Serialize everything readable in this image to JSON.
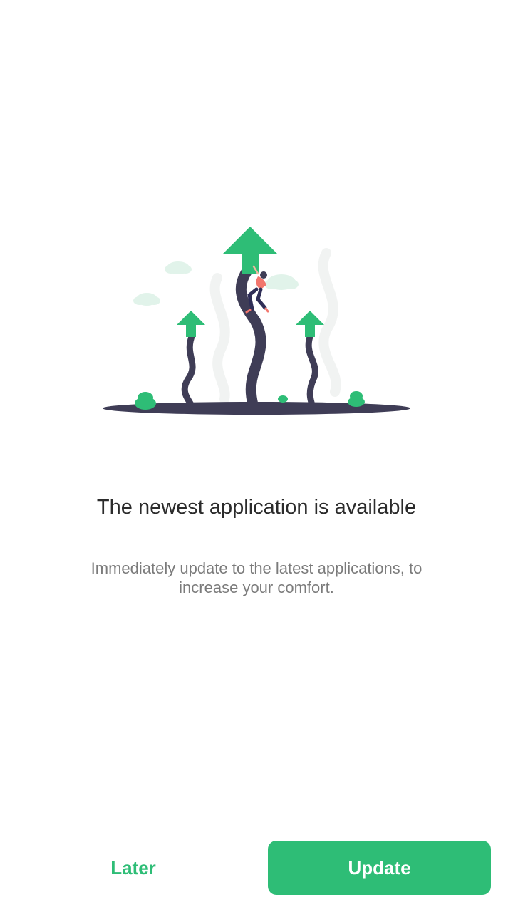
{
  "illustration": {
    "icon": "growing-upload-arrows-illustration",
    "accent_color": "#2ebd76",
    "stem_color": "#3f3d56",
    "figure_color": "#f2766d"
  },
  "dialog": {
    "title": "The newest application is available",
    "subtitle": "Immediately update to the latest applications, to increase your comfort."
  },
  "actions": {
    "later_label": "Later",
    "update_label": "Update"
  },
  "colors": {
    "primary": "#2ebd76",
    "title_text": "#2b2b2b",
    "body_text": "#7b7b7b",
    "background": "#ffffff"
  }
}
